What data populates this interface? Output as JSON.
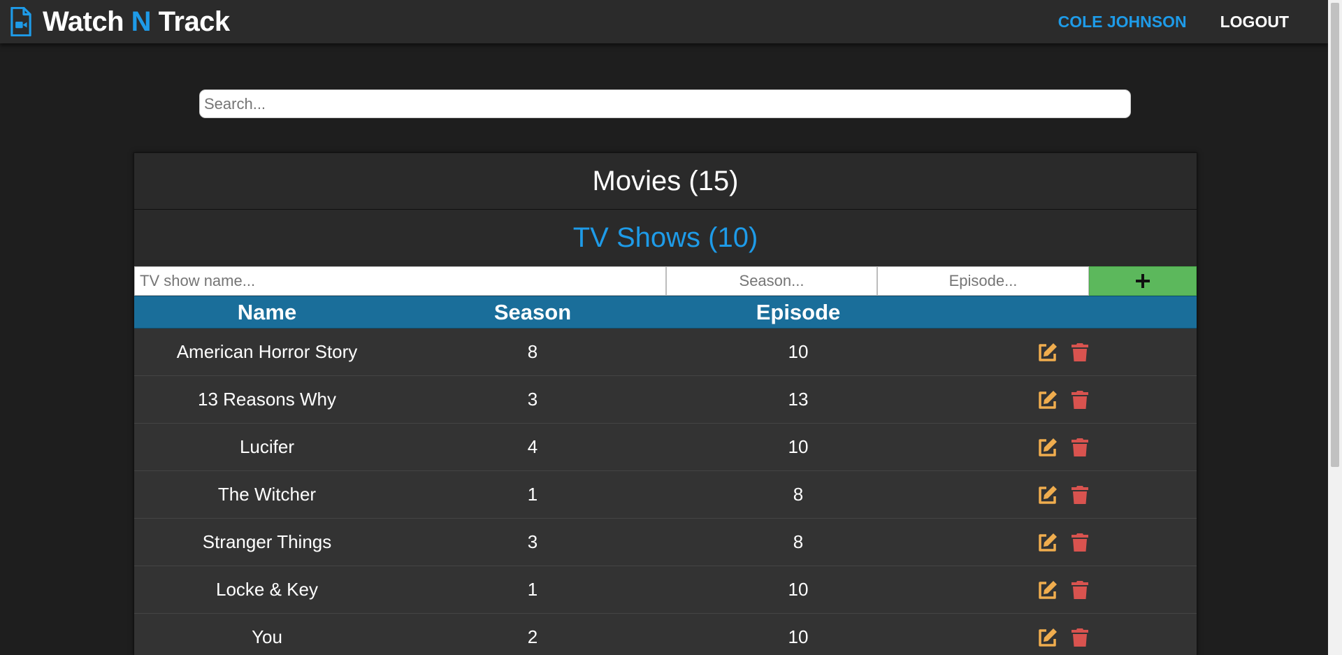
{
  "nav": {
    "brand_part1": "Watch ",
    "brand_accent": "N",
    "brand_part2": " Track",
    "user": "COLE JOHNSON",
    "logout": "LOGOUT"
  },
  "search": {
    "placeholder": "Search..."
  },
  "sections": {
    "movies": "Movies (15)",
    "tv": "TV Shows (10)"
  },
  "add_form": {
    "name_placeholder": "TV show name...",
    "season_placeholder": "Season...",
    "episode_placeholder": "Episode...",
    "add_icon": "plus-icon"
  },
  "table": {
    "headers": {
      "name": "Name",
      "season": "Season",
      "episode": "Episode"
    },
    "rows": [
      {
        "name": "American Horror Story",
        "season": "8",
        "episode": "10"
      },
      {
        "name": "13 Reasons Why",
        "season": "3",
        "episode": "13"
      },
      {
        "name": "Lucifer",
        "season": "4",
        "episode": "10"
      },
      {
        "name": "The Witcher",
        "season": "1",
        "episode": "8"
      },
      {
        "name": "Stranger Things",
        "season": "3",
        "episode": "8"
      },
      {
        "name": "Locke & Key",
        "season": "1",
        "episode": "10"
      },
      {
        "name": "You",
        "season": "2",
        "episode": "10"
      }
    ],
    "row_icons": [
      "edit-icon",
      "trash-icon"
    ]
  },
  "colors": {
    "accent": "#1e9be8",
    "background": "#1e1e1e",
    "panel": "#2a2a2a",
    "table_header": "#1a6e9a",
    "add_button": "#5cb85c",
    "edit": "#f0ad4e",
    "delete": "#d9534f"
  }
}
